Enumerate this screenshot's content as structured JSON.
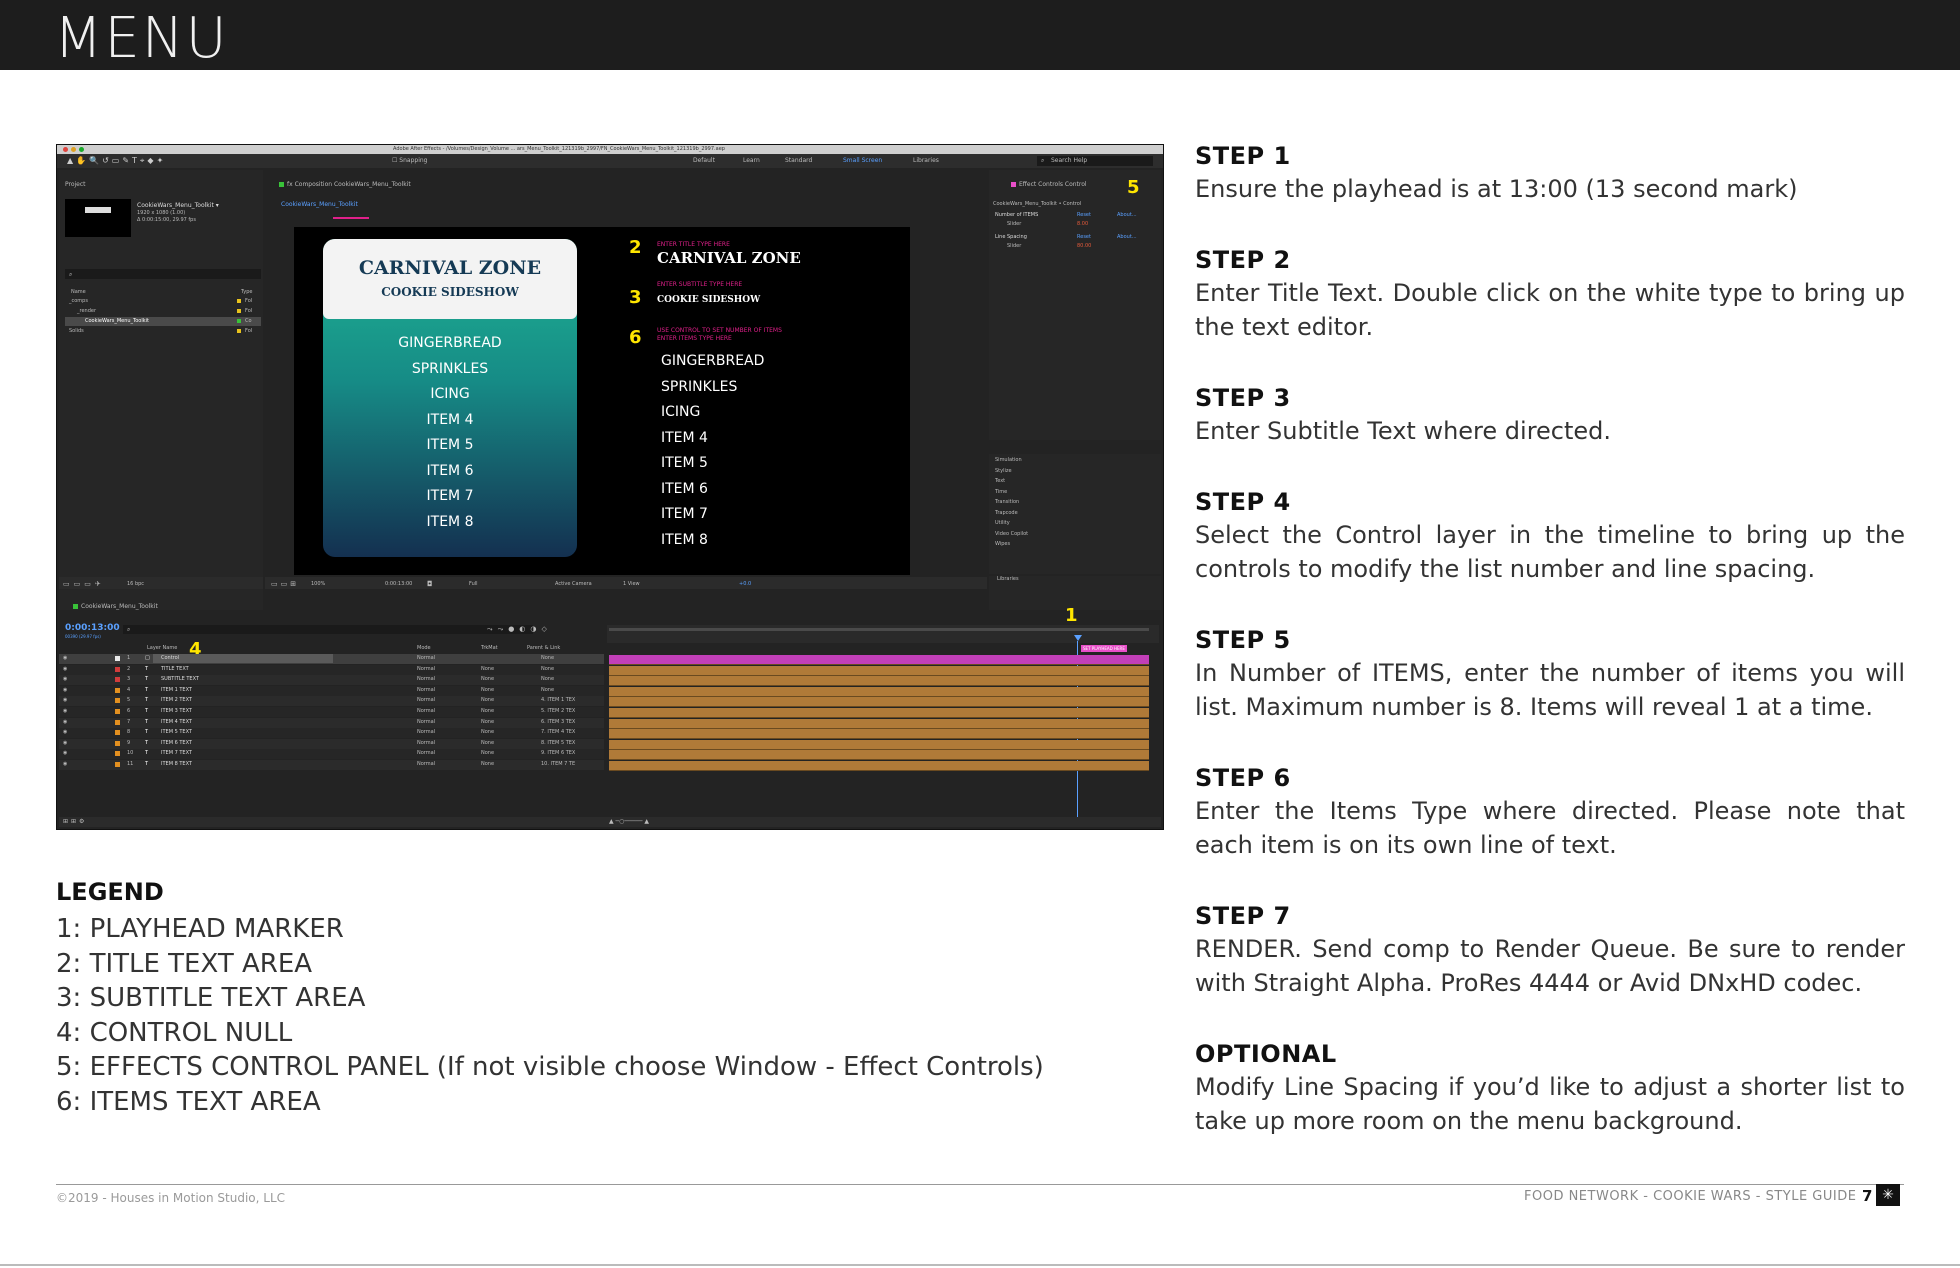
{
  "header": {
    "title": "MENU"
  },
  "screenshot": {
    "window_title": "Adobe After Effects - /Volumes/Design_Volume ... ars_Menu_Toolkit_121319b_2997/FN_CookieWars_Menu_Toolkit_121319b_2997.aep",
    "snapping": "Snapping",
    "workspaces": [
      "Default",
      "Learn",
      "Standard",
      "Small Screen",
      "Libraries"
    ],
    "search_help": "Search Help",
    "project": {
      "tab": "Project",
      "item_name": "CookieWars_Menu_Toolkit ▾",
      "item_info": [
        "1920 x 1080 (1.00)",
        "Δ 0:00:15:00, 29.97 fps"
      ],
      "col_name": "Name",
      "col_type": "Type",
      "tree": [
        {
          "label": "_comps",
          "type": "Fol"
        },
        {
          "label": "_render",
          "type": "Fol"
        },
        {
          "label": "CookieWars_Menu_Toolkit",
          "type": "Co"
        },
        {
          "label": "Solids",
          "type": "Fol"
        }
      ],
      "bpc": "16 bpc"
    },
    "composition": {
      "tab": "Composition CookieWars_Menu_Toolkit",
      "subtab": "CookieWars_Menu_Toolkit",
      "zoom": "100%",
      "timecode": "0:00:13:00",
      "resolution": "Full",
      "camera": "Active Camera",
      "view": "1 View",
      "exposure": "+0.0"
    },
    "menu_card": {
      "title": "CARNIVAL ZONE",
      "subtitle": "COOKIE SIDESHOW",
      "items": [
        "GINGERBREAD",
        "SPRINKLES",
        "ICING",
        "ITEM 4",
        "ITEM 5",
        "ITEM 6",
        "ITEM 7",
        "ITEM 8"
      ]
    },
    "annotations": {
      "title_hint": "ENTER TITLE TYPE HERE",
      "title": "CARNIVAL ZONE",
      "subtitle_hint": "ENTER SUBTITLE TYPE HERE",
      "subtitle": "COOKIE SIDESHOW",
      "items_hint_1": "USE CONTROL TO SET NUMBER OF ITEMS",
      "items_hint_2": "ENTER ITEMS TYPE HERE",
      "items": [
        "GINGERBREAD",
        "SPRINKLES",
        "ICING",
        "ITEM 4",
        "ITEM 5",
        "ITEM 6",
        "ITEM 7",
        "ITEM 8"
      ]
    },
    "markers": {
      "m1": "1",
      "m2": "2",
      "m3": "3",
      "m4": "4",
      "m5": "5",
      "m6": "6"
    },
    "effect_controls": {
      "tab": "Effect Controls Control",
      "path": "CookieWars_Menu_Toolkit • Control",
      "effects": [
        {
          "name": "Number of ITEMS",
          "reset": "Reset",
          "about": "About...",
          "param": "Slider",
          "value": "8.00"
        },
        {
          "name": "Line Spacing",
          "reset": "Reset",
          "about": "About...",
          "param": "Slider",
          "value": "80.00"
        }
      ]
    },
    "effects_list": [
      "Simulation",
      "Stylize",
      "Text",
      "Time",
      "Transition",
      "Trapcode",
      "Utility",
      "Video Copilot",
      "Wipes"
    ],
    "libraries": "Libraries",
    "timeline": {
      "tab": "CookieWars_Menu_Toolkit",
      "timecode": "0:00:13:00",
      "fps": "00390 (29.97 fps)",
      "col_layer": "Layer Name",
      "col_mode": "Mode",
      "col_trkmat": "TrkMat",
      "col_parent": "Parent & Link",
      "playhead_label": "SET PLAYHEAD HERE",
      "layers": [
        {
          "num": "1",
          "name": "Control",
          "mode": "Normal",
          "trkmat": "",
          "parent": "None",
          "color": "#e9e9e9"
        },
        {
          "num": "2",
          "name": "TITLE TEXT",
          "mode": "Normal",
          "trkmat": "None",
          "parent": "None",
          "color": "#d23c3c"
        },
        {
          "num": "3",
          "name": "SUBTITLE TEXT",
          "mode": "Normal",
          "trkmat": "None",
          "parent": "None",
          "color": "#d23c3c"
        },
        {
          "num": "4",
          "name": "ITEM 1 TEXT",
          "mode": "Normal",
          "trkmat": "None",
          "parent": "None",
          "color": "#e39020"
        },
        {
          "num": "5",
          "name": "ITEM 2 TEXT",
          "mode": "Normal",
          "trkmat": "None",
          "parent": "4. ITEM 1 TEX",
          "color": "#e39020"
        },
        {
          "num": "6",
          "name": "ITEM 3 TEXT",
          "mode": "Normal",
          "trkmat": "None",
          "parent": "5. ITEM 2 TEX",
          "color": "#e39020"
        },
        {
          "num": "7",
          "name": "ITEM 4 TEXT",
          "mode": "Normal",
          "trkmat": "None",
          "parent": "6. ITEM 3 TEX",
          "color": "#e39020"
        },
        {
          "num": "8",
          "name": "ITEM 5 TEXT",
          "mode": "Normal",
          "trkmat": "None",
          "parent": "7. ITEM 4 TEX",
          "color": "#e39020"
        },
        {
          "num": "9",
          "name": "ITEM 6 TEXT",
          "mode": "Normal",
          "trkmat": "None",
          "parent": "8. ITEM 5 TEX",
          "color": "#e39020"
        },
        {
          "num": "10",
          "name": "ITEM 7 TEXT",
          "mode": "Normal",
          "trkmat": "None",
          "parent": "9. ITEM 6 TEX",
          "color": "#e39020"
        },
        {
          "num": "11",
          "name": "ITEM 8 TEXT",
          "mode": "Normal",
          "trkmat": "None",
          "parent": "10. ITEM 7 TE",
          "color": "#e39020"
        }
      ]
    }
  },
  "steps": [
    {
      "heading": "STEP 1",
      "body": "Ensure the playhead is at 13:00 (13 second mark)"
    },
    {
      "heading": "STEP 2",
      "body": "Enter Title Text. Double click on the white type to bring up the text editor."
    },
    {
      "heading": "STEP 3",
      "body": "Enter Subtitle Text where directed."
    },
    {
      "heading": "STEP 4",
      "body": "Select the Control layer in the timeline to bring up the controls to modify the list number and line spacing."
    },
    {
      "heading": "STEP 5",
      "body": "In Number of ITEMS, enter the number of items you will list. Maximum number is 8. Items will reveal 1 at a time."
    },
    {
      "heading": "STEP 6",
      "body": "Enter the Items Type where directed. Please note that each item is on its own line of text."
    },
    {
      "heading": "STEP 7",
      "body": "RENDER. Send comp to Render Queue. Be sure to render with Straight Alpha. ProRes 4444 or Avid DNxHD codec."
    },
    {
      "heading": "OPTIONAL",
      "body": "Modify Line Spacing if you’d like to adjust a shorter list to take up more room on the menu background."
    }
  ],
  "legend": {
    "heading": "LEGEND",
    "items": [
      "1: PLAYHEAD MARKER",
      "2: TITLE TEXT AREA",
      "3: SUBTITLE TEXT AREA",
      "4: CONTROL NULL",
      "5: EFFECTS CONTROL PANEL (If not visible choose Window - Effect Controls)",
      "6: ITEMS TEXT AREA"
    ]
  },
  "footer": {
    "copyright": "©2019 - Houses in Motion Studio, LLC",
    "guide": "FOOD NETWORK - COOKIE WARS - STYLE GUIDE",
    "page": "7"
  },
  "colors": {
    "header_bg": "#1d1d1d",
    "marker_yellow": "#ffe600",
    "hint_magenta": "#e0208a",
    "timeline_bar": "#b07a38",
    "control_bar": "#c23fb8",
    "card_teal": "#1fb594",
    "card_navy": "#143050"
  }
}
